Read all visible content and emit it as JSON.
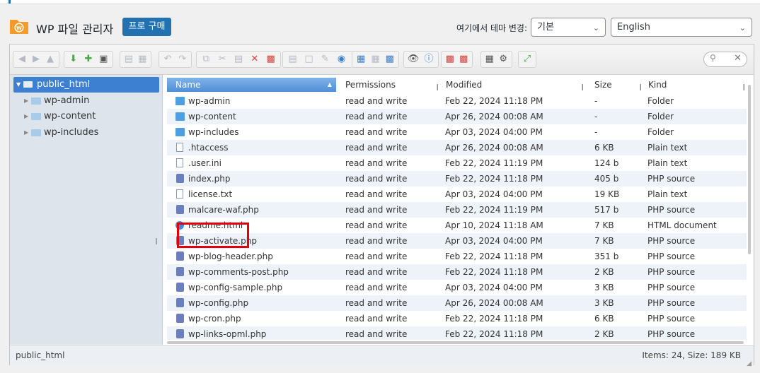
{
  "header": {
    "title": "WP 파일 관리자",
    "pro_button": "프로 구매",
    "theme_label": "여기에서 테마 변경:",
    "theme_select": "기본",
    "language_select": "English"
  },
  "tree": {
    "root": "public_html",
    "children": [
      "wp-admin",
      "wp-content",
      "wp-includes"
    ]
  },
  "columns": {
    "name": "Name",
    "permissions": "Permissions",
    "modified": "Modified",
    "size": "Size",
    "kind": "Kind"
  },
  "files": [
    {
      "name": "wp-admin",
      "icon": "folder",
      "permissions": "read and write",
      "modified": "Feb 22, 2024 11:18 PM",
      "size": "-",
      "kind": "Folder"
    },
    {
      "name": "wp-content",
      "icon": "folder",
      "permissions": "read and write",
      "modified": "Apr 26, 2024 00:08 AM",
      "size": "-",
      "kind": "Folder"
    },
    {
      "name": "wp-includes",
      "icon": "folder",
      "permissions": "read and write",
      "modified": "Apr 03, 2024 04:00 PM",
      "size": "-",
      "kind": "Folder"
    },
    {
      "name": ".htaccess",
      "icon": "text",
      "permissions": "read and write",
      "modified": "Apr 26, 2024 00:08 AM",
      "size": "6 KB",
      "kind": "Plain text"
    },
    {
      "name": ".user.ini",
      "icon": "text",
      "permissions": "read and write",
      "modified": "Feb 22, 2024 11:19 PM",
      "size": "124 b",
      "kind": "Plain text"
    },
    {
      "name": "index.php",
      "icon": "php",
      "permissions": "read and write",
      "modified": "Feb 22, 2024 11:18 PM",
      "size": "405 b",
      "kind": "PHP source"
    },
    {
      "name": "license.txt",
      "icon": "text",
      "permissions": "read and write",
      "modified": "Apr 03, 2024 04:00 PM",
      "size": "19 KB",
      "kind": "Plain text"
    },
    {
      "name": "malcare-waf.php",
      "icon": "php",
      "permissions": "read and write",
      "modified": "Feb 22, 2024 11:19 PM",
      "size": "517 b",
      "kind": "PHP source"
    },
    {
      "name": "readme.html",
      "icon": "html",
      "permissions": "read and write",
      "modified": "Apr 10, 2024 11:18 AM",
      "size": "7 KB",
      "kind": "HTML document"
    },
    {
      "name": "wp-activate.php",
      "icon": "php",
      "permissions": "read and write",
      "modified": "Apr 03, 2024 04:00 PM",
      "size": "7 KB",
      "kind": "PHP source"
    },
    {
      "name": "wp-blog-header.php",
      "icon": "php",
      "permissions": "read and write",
      "modified": "Feb 22, 2024 11:18 PM",
      "size": "351 b",
      "kind": "PHP source"
    },
    {
      "name": "wp-comments-post.php",
      "icon": "php",
      "permissions": "read and write",
      "modified": "Feb 22, 2024 11:18 PM",
      "size": "2 KB",
      "kind": "PHP source"
    },
    {
      "name": "wp-config-sample.php",
      "icon": "php",
      "permissions": "read and write",
      "modified": "Apr 03, 2024 04:00 PM",
      "size": "3 KB",
      "kind": "PHP source"
    },
    {
      "name": "wp-config.php",
      "icon": "php",
      "permissions": "read and write",
      "modified": "Apr 26, 2024 00:08 AM",
      "size": "3 KB",
      "kind": "PHP source"
    },
    {
      "name": "wp-cron.php",
      "icon": "php",
      "permissions": "read and write",
      "modified": "Feb 22, 2024 11:18 PM",
      "size": "6 KB",
      "kind": "PHP source"
    },
    {
      "name": "wp-links-opml.php",
      "icon": "php",
      "permissions": "read and write",
      "modified": "Feb 22, 2024 11:18 PM",
      "size": "2 KB",
      "kind": "PHP source"
    }
  ],
  "status": {
    "path": "public_html",
    "summary": "Items: 24, Size: 189 KB"
  }
}
